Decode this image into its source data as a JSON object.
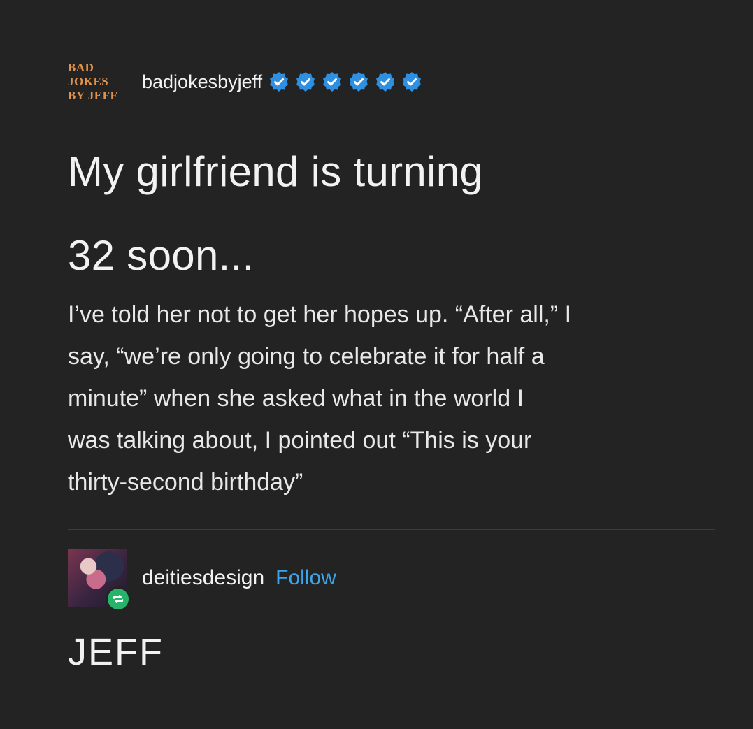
{
  "post": {
    "logo_lines": [
      "BAD",
      "JOKES",
      "BY JEFF"
    ],
    "username": "badjokesbyjeff",
    "verified_badge_count": 6,
    "badge_color": "#2f8fe0",
    "title_lines": [
      "My girlfriend is turning",
      "32 soon..."
    ],
    "body_lines": [
      "I’ve told her not to get her hopes up. “After all,” I",
      "say, “we’re only going to celebrate it for half a",
      "minute” when she asked what in the world I",
      "was talking about, I pointed out “This is your",
      "thirty-second birthday”"
    ]
  },
  "reblog": {
    "username": "deitiesdesign",
    "follow_label": "Follow",
    "follow_color": "#3ca5e8",
    "reblog_icon_color": "#28b36a",
    "comment": "JEFF"
  },
  "colors": {
    "background": "#232323",
    "logo": "#e0914a"
  }
}
